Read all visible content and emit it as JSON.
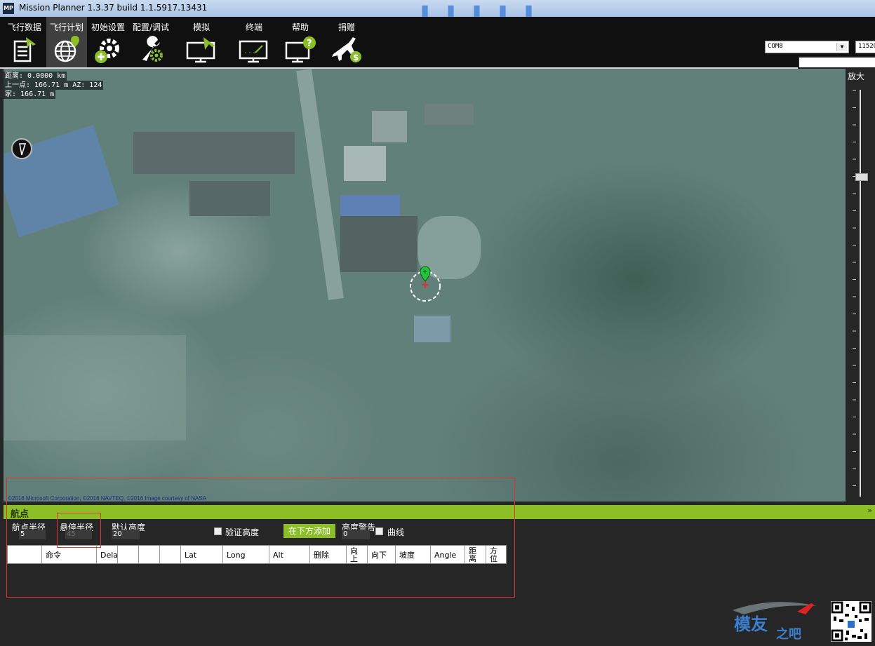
{
  "window": {
    "title": "Mission Planner 1.3.37 build 1.1.5917.13431",
    "app_icon": "MP"
  },
  "menu": [
    {
      "label": "飞行数据",
      "icon": "flight-data-icon"
    },
    {
      "label": "飞行计划",
      "icon": "flight-plan-icon",
      "active": true
    },
    {
      "label": "初始设置",
      "icon": "initial-setup-icon"
    },
    {
      "label": "配置/调试",
      "icon": "config-tuning-icon"
    },
    {
      "label": "模拟",
      "icon": "simulation-icon"
    },
    {
      "label": "终端",
      "icon": "terminal-icon"
    },
    {
      "label": "帮助",
      "icon": "help-icon"
    },
    {
      "label": "捐赠",
      "icon": "donate-icon"
    }
  ],
  "connection": {
    "port": "COM8",
    "baud": "11520"
  },
  "map": {
    "info": {
      "distance": "距离: 0.0000 km",
      "prev_point": "上一点: 166.71 m AZ: 124",
      "home": "家: 166.71 m"
    },
    "copyright": "©2016 Microsoft Corporation, ©2016 NAVTEQ, ©2016 Image courtesy of NASA",
    "zoom_label": "放大",
    "zoom_level_fraction": 0.22
  },
  "waypoints": {
    "header": "航点",
    "wp_radius_label": "航点半径",
    "wp_radius_value": "5",
    "loiter_radius_label": "悬停半径",
    "loiter_radius_value": "45",
    "default_alt_label": "默认高度",
    "default_alt_value": "20",
    "verify_height_label": "验证高度",
    "verify_height_checked": false,
    "add_below_label": "在下方添加",
    "alt_warn_label": "高度警告",
    "alt_warn_value": "0",
    "spline_label": "曲线",
    "spline_checked": false,
    "columns": [
      "",
      "命令",
      "Dela",
      "",
      "",
      "",
      "Lat",
      "Long",
      "Alt",
      "删除",
      "向上",
      "向下",
      "坡度",
      "Angle",
      "距离",
      "方位"
    ]
  },
  "colors": {
    "accent_green": "#8cbf26",
    "background": "#262626",
    "annotation_red": "#dd3333"
  }
}
